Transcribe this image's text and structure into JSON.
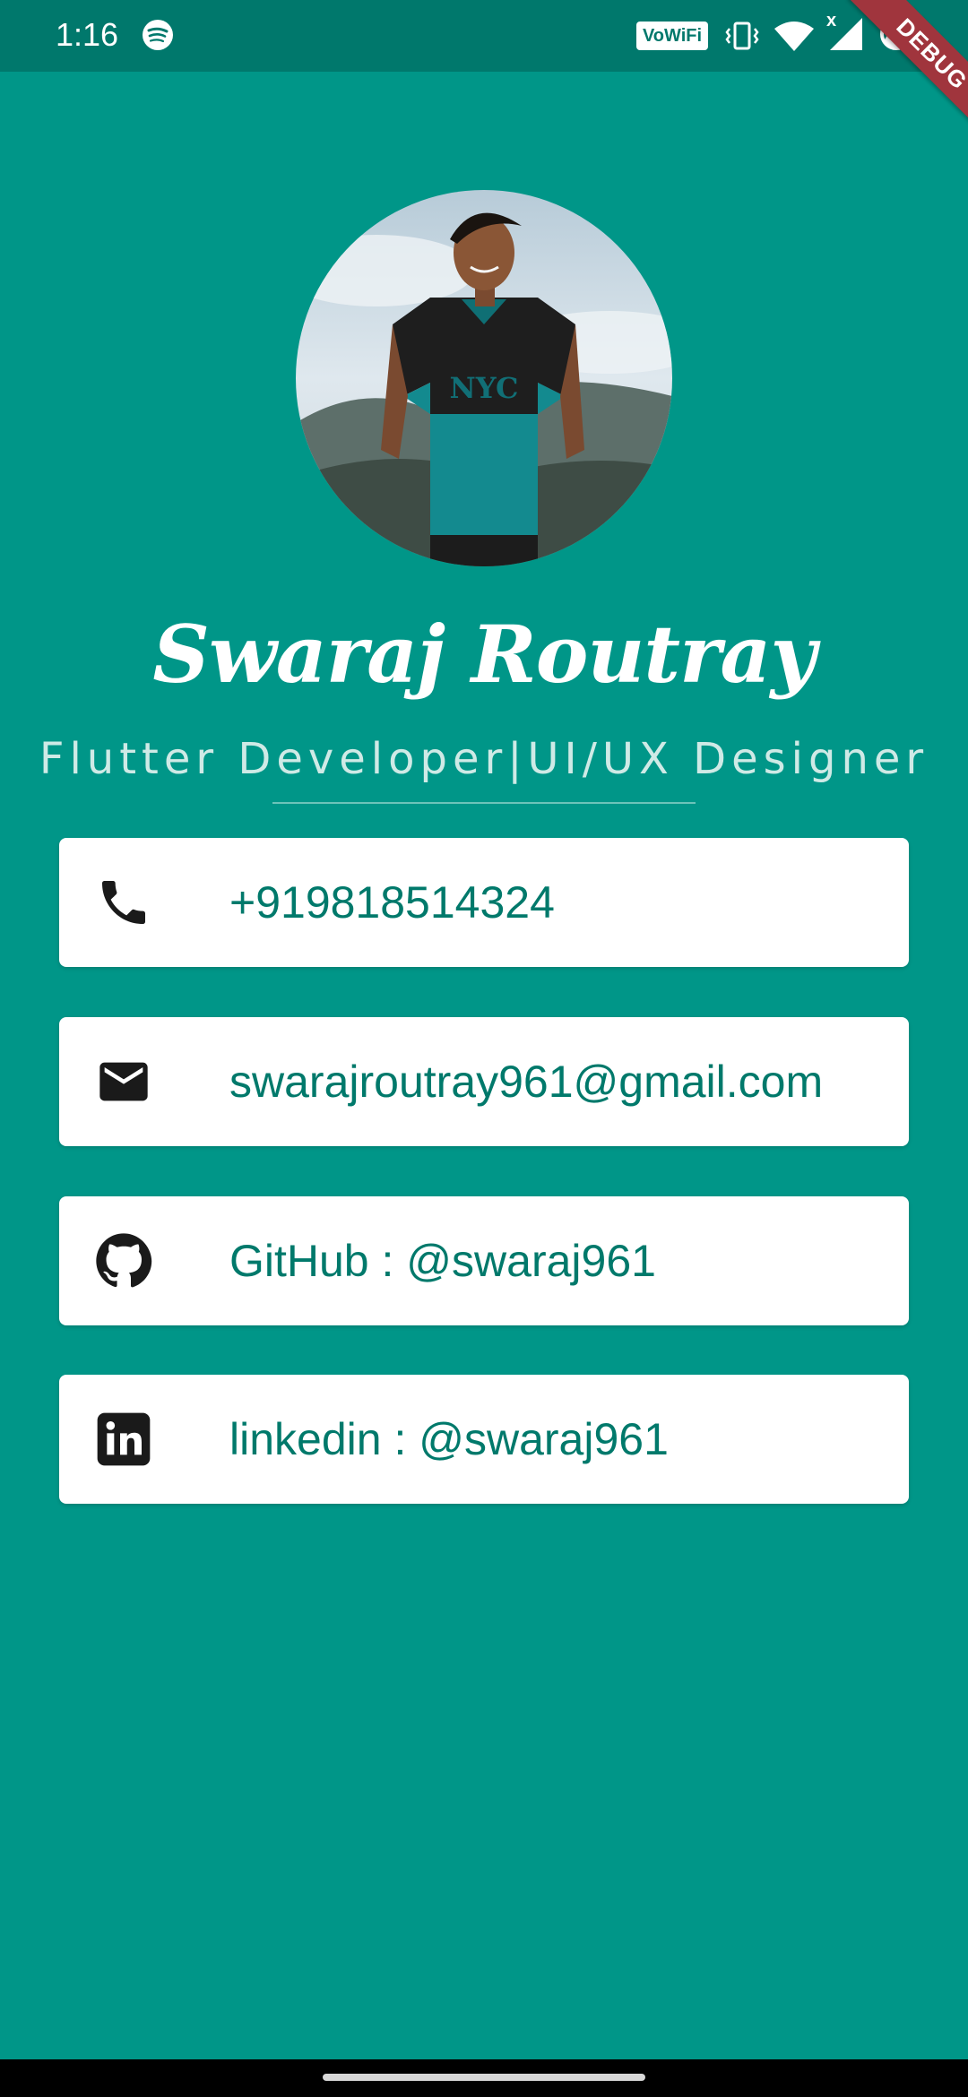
{
  "status_bar": {
    "time": "1:16",
    "vowifi": "VoWiFi",
    "signal_mark": "x",
    "icons": [
      "spotify-icon",
      "vowifi-badge",
      "vibrate-icon",
      "wifi-icon",
      "signal-icon",
      "battery-icon"
    ]
  },
  "debug_banner": "DEBUG",
  "profile": {
    "name": "Swaraj Routray",
    "subtitle": "Flutter Developer|UI/UX Designer"
  },
  "contacts": [
    {
      "icon": "phone-icon",
      "text": "+919818514324"
    },
    {
      "icon": "email-icon",
      "text": "swarajroutray961@gmail.com"
    },
    {
      "icon": "github-icon",
      "text": "GitHub : @swaraj961"
    },
    {
      "icon": "linkedin-icon",
      "text": "linkedin : @swaraj961"
    }
  ],
  "colors": {
    "background": "#009688",
    "status_bar": "#00786c",
    "card": "#ffffff",
    "card_text": "#00796b",
    "debug_ribbon": "#a0353d"
  }
}
